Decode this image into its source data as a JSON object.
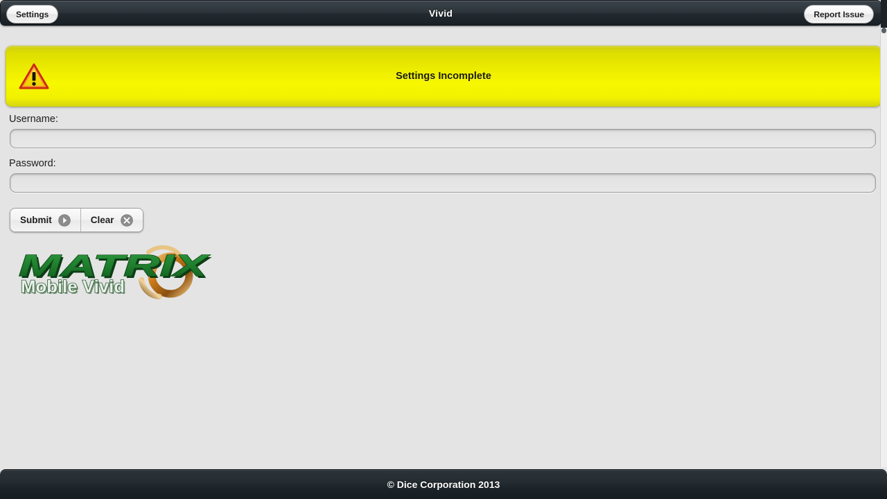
{
  "header": {
    "title": "Vivid",
    "left_button": "Settings",
    "right_button": "Report Issue"
  },
  "banner": {
    "message": "Settings Incomplete",
    "icon": "warning-triangle-icon",
    "background_color": "#f2f200",
    "text_color": "#1b1b00"
  },
  "form": {
    "username": {
      "label": "Username:",
      "value": "",
      "placeholder": ""
    },
    "password": {
      "label": "Password:",
      "value": "",
      "placeholder": ""
    },
    "buttons": [
      {
        "label": "Submit",
        "icon": "arrow-right-circle-icon"
      },
      {
        "label": "Clear",
        "icon": "close-circle-icon"
      }
    ]
  },
  "logo": {
    "brand": "MATRIX",
    "tagline": "Mobile Vivid",
    "brand_color": "#1f7a2e",
    "ring_color": "#c8791a"
  },
  "footer": {
    "copyright": "© Dice Corporation 2013"
  }
}
